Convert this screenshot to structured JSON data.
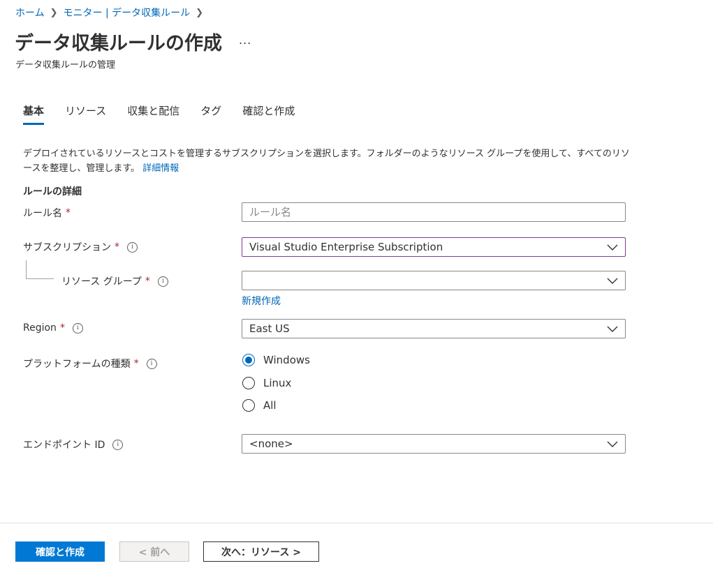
{
  "breadcrumb": {
    "items": [
      "ホーム",
      "モニター | データ収集ルール"
    ]
  },
  "header": {
    "title": "データ収集ルールの作成",
    "more": "...",
    "subtitle": "データ収集ルールの管理"
  },
  "tabs": [
    {
      "label": "基本",
      "active": true
    },
    {
      "label": "リソース",
      "active": false
    },
    {
      "label": "収集と配信",
      "active": false
    },
    {
      "label": "タグ",
      "active": false
    },
    {
      "label": "確認と作成",
      "active": false
    }
  ],
  "description": {
    "text": "デプロイされているリソースとコストを管理するサブスクリプションを選択します。フォルダーのようなリソース グループを使用して、すべてのリソースを整理し、管理します。",
    "link": "詳細情報"
  },
  "section": {
    "title": "ルールの詳細"
  },
  "form": {
    "rule_name": {
      "label": "ルール名",
      "required": "*",
      "placeholder": "ルール名",
      "value": ""
    },
    "subscription": {
      "label": "サブスクリプション",
      "required": "*",
      "value": "Visual Studio Enterprise Subscription"
    },
    "resource_group": {
      "label": "リソース グループ",
      "required": "*",
      "value": "",
      "new_link": "新規作成"
    },
    "region": {
      "label": "Region",
      "required": "*",
      "value": "East US"
    },
    "platform": {
      "label": "プラットフォームの種類",
      "required": "*",
      "options": [
        "Windows",
        "Linux",
        "All"
      ],
      "selected": "Windows"
    },
    "endpoint": {
      "label": "エンドポイント ID",
      "value": "<none>"
    }
  },
  "info_glyph": "i",
  "footer": {
    "primary": "確認と作成",
    "previous": "< 前へ",
    "next": "次へ：リソース >"
  },
  "colors": {
    "accent": "#0067b8",
    "primary_button": "#0078d4",
    "required": "#a4262c",
    "focus_border": "#7e3c8c"
  }
}
